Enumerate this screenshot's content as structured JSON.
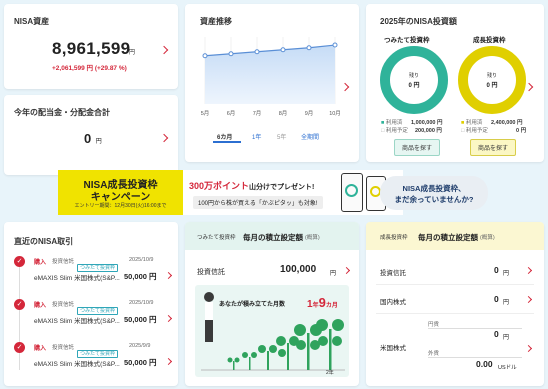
{
  "asset": {
    "title": "NISA資産",
    "value": "8,961,599",
    "unit": "円",
    "change": "+2,061,599 円 (+29.87 %)"
  },
  "dividends": {
    "title": "今年の配当金・分配金合計",
    "value": "0",
    "unit": "円"
  },
  "chart": {
    "title": "資産推移",
    "periods": [
      "6カ月",
      "1年",
      "5年",
      "全期間"
    ],
    "selected_period": "6カ月"
  },
  "chart_data": {
    "type": "area",
    "categories": [
      "5月",
      "6月",
      "7月",
      "8月",
      "9月",
      "10月"
    ],
    "values": [
      72,
      75,
      78,
      81,
      84,
      88
    ],
    "ylim": [
      0,
      100
    ]
  },
  "nisa2025": {
    "title": "2025年のNISA投資額",
    "tsumitate": {
      "label": "つみたて投資枠",
      "remaining_label": "残り",
      "remaining_value": "0 円",
      "used_label": "利用済",
      "used_value": "1,000,000 円",
      "planned_label": "利用予定",
      "planned_value": "200,000 円",
      "button": "商品を探す"
    },
    "seicho": {
      "label": "成長投資枠",
      "remaining_label": "残り",
      "remaining_value": "0 円",
      "used_label": "利用済",
      "used_value": "2,400,000 円",
      "planned_label": "利用予定",
      "planned_value": "0 円",
      "button": "商品を探す"
    },
    "tsumitate_color": "#2fb39a",
    "seicho_color": "#e0cf00"
  },
  "banner": {
    "title_line1": "NISA成長投資枠",
    "title_line2": "キャンペーン",
    "period": "エントリー期間：12月30日(火)16:00まで",
    "points": "300万ポイント",
    "points_suffix": "山分けでプレゼント!",
    "sub": "100円から株が買える「かぶピタッ」も対象!",
    "bubble_line1": "NISA成長投資枠、",
    "bubble_line2": "まだ余っていませんか?"
  },
  "recent": {
    "title": "直近のNISA取引",
    "items": [
      {
        "type": "購入",
        "category": "投資信託",
        "badge": "つみたて投資枠",
        "date": "2025/10/9",
        "name": "eMAXIS Slim 米国株式(S&P...",
        "amount": "50,000 円"
      },
      {
        "type": "購入",
        "category": "投資信託",
        "badge": "つみたて投資枠",
        "date": "2025/10/9",
        "name": "eMAXIS Slim 米国株式(S&P...",
        "amount": "50,000 円"
      },
      {
        "type": "購入",
        "category": "投資信託",
        "badge": "つみたて投資枠",
        "date": "2025/9/9",
        "name": "eMAXIS Slim 米国株式(S&P...",
        "amount": "50,000 円"
      }
    ]
  },
  "tsumitate_plan": {
    "badge": "つみたて投資枠",
    "title": "毎月の積立設定額",
    "note": "(概算)",
    "row_label": "投資信託",
    "row_value": "100,000",
    "row_unit": "円",
    "months_label": "あなたが積み立てた月数",
    "years": "1",
    "years_unit": "年",
    "months": "9",
    "months_unit": "カ月",
    "axis_label": "2年"
  },
  "seicho_plan": {
    "badge": "成長投資枠",
    "title": "毎月の積立設定額",
    "note": "(概算)",
    "rows": [
      {
        "label": "投資信託",
        "value": "0",
        "unit": "円"
      },
      {
        "label": "国内株式",
        "value": "0",
        "unit": "円"
      },
      {
        "label": "米国株式",
        "sub1_label": "円貨",
        "sub1_value": "0",
        "sub1_unit": "円",
        "sub2_label": "外貨",
        "sub2_value": "0.00",
        "sub2_unit": "USドル"
      }
    ]
  }
}
